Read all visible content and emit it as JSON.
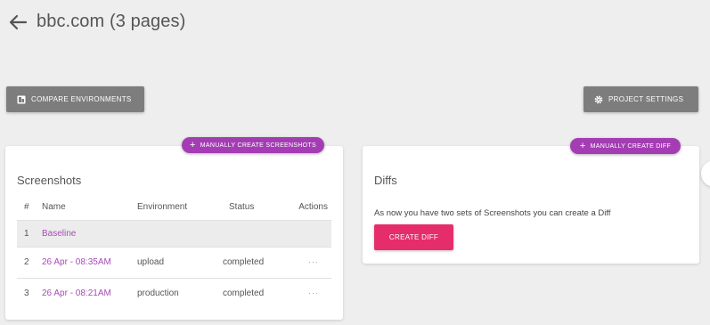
{
  "header": {
    "title": "bbc.com (3 pages)",
    "back_icon": "arrow-left-icon"
  },
  "toolbar": {
    "compare_label": "Compare Environments",
    "compare_icon": "compare-icon",
    "settings_label": "Project Settings",
    "settings_icon": "gear-icon"
  },
  "screenshots": {
    "create_label": "Manually Create Screenshots",
    "title": "Screenshots",
    "columns": [
      "#",
      "Name",
      "Environment",
      "Status",
      "Actions"
    ],
    "rows": [
      {
        "num": "1",
        "name": "Baseline",
        "environment": "",
        "status": "",
        "actions": ""
      },
      {
        "num": "2",
        "name": "26 Apr - 08:35AM",
        "environment": "upload",
        "status": "completed",
        "actions": "···"
      },
      {
        "num": "3",
        "name": "26 Apr - 08:21AM",
        "environment": "production",
        "status": "completed",
        "actions": "···"
      }
    ]
  },
  "diffs": {
    "create_label": "Manually Create Diff",
    "title": "Diffs",
    "message": "As now you have two sets of Screenshots you can create a Diff",
    "button_label": "Create Diff"
  },
  "colors": {
    "accent_purple": "#a43db4",
    "link_purple": "#a84bb8",
    "create_pink": "#e52d6b",
    "grey_button": "#7d7d7d"
  }
}
